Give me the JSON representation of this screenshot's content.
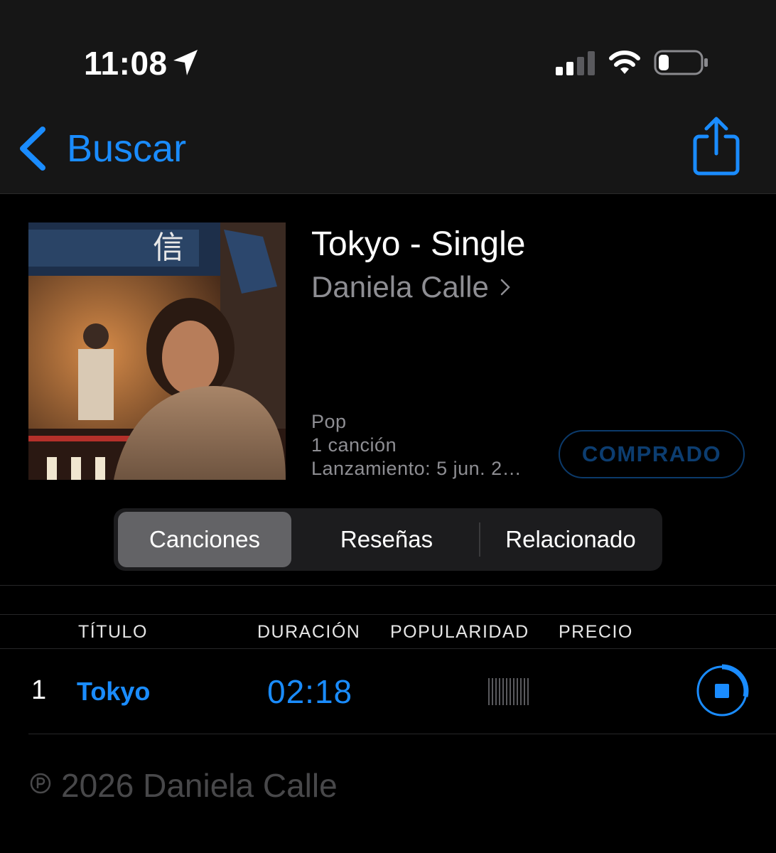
{
  "status_bar": {
    "time": "11:08",
    "icons": [
      "location-arrow-icon",
      "cellular-signal-icon",
      "wifi-icon",
      "battery-icon"
    ]
  },
  "nav": {
    "back_label": "Buscar",
    "icons": [
      "chevron-left-icon",
      "share-icon"
    ]
  },
  "album": {
    "title": "Tokyo - Single",
    "artist": "Daniela Calle",
    "genre": "Pop",
    "track_count": "1 canción",
    "release": "Lanzamiento: 5 jun. 2…",
    "purchase_label": "COMPRADO"
  },
  "tabs": [
    {
      "label": "Canciones",
      "active": true
    },
    {
      "label": "Reseñas",
      "active": false
    },
    {
      "label": "Relacionado",
      "active": false
    }
  ],
  "table": {
    "headers": [
      "TÍTULO",
      "DURACIÓN",
      "POPULARIDAD",
      "PRECIO"
    ],
    "rows": [
      {
        "number": "1",
        "title": "Tokyo",
        "duration": "02:18",
        "popularity_icon": "popularity-bars-icon",
        "action_icon": "stop-download-icon"
      }
    ]
  },
  "copyright": "2026 Daniela Calle",
  "colors": {
    "accent": "#1a8cff",
    "background": "#000000",
    "nav_background": "#161616",
    "secondary_text": "#8e8e93",
    "purchased": "#0c3d70"
  }
}
